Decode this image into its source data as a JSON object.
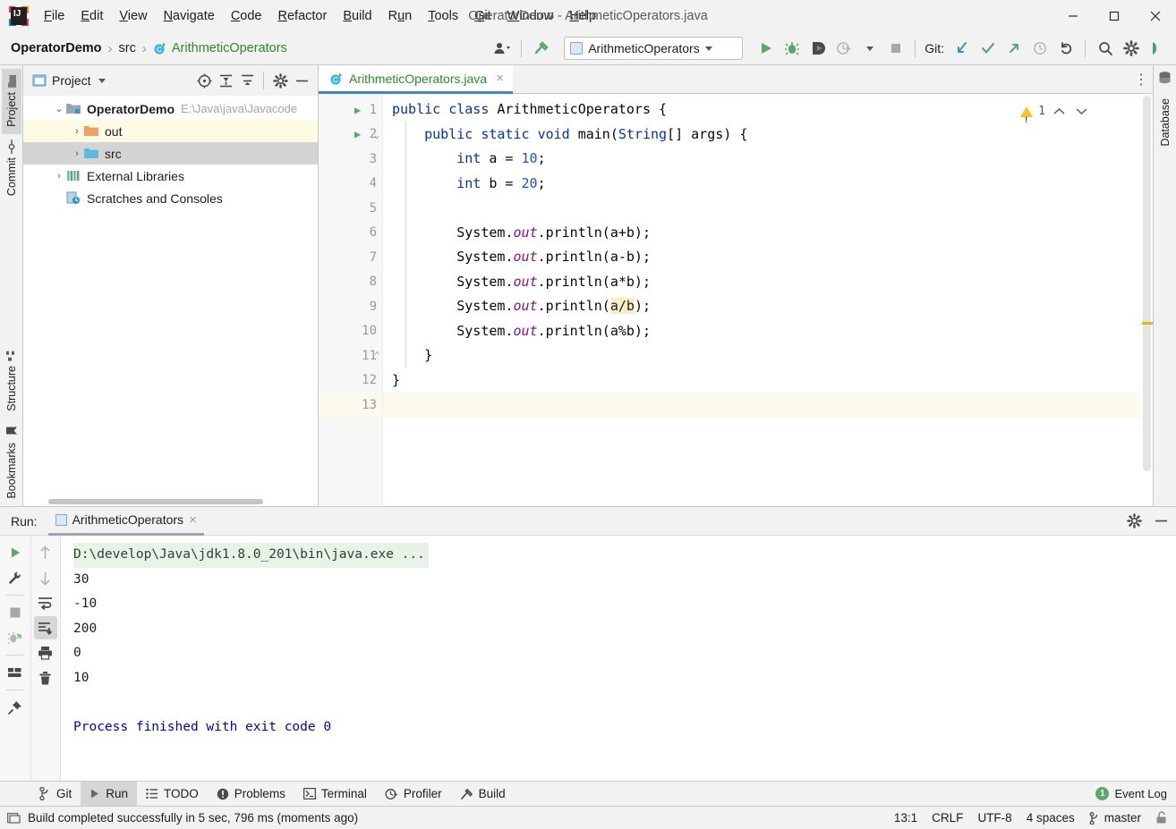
{
  "window": {
    "title": "OperatorDemo - ArithmeticOperators.java",
    "minimize": "–",
    "maximize": "□",
    "close": "✕"
  },
  "menu": [
    {
      "label": "File",
      "mnemonic": "F"
    },
    {
      "label": "Edit",
      "mnemonic": "E"
    },
    {
      "label": "View",
      "mnemonic": "V"
    },
    {
      "label": "Navigate",
      "mnemonic": "N"
    },
    {
      "label": "Code",
      "mnemonic": "C"
    },
    {
      "label": "Refactor",
      "mnemonic": "R"
    },
    {
      "label": "Build",
      "mnemonic": "B"
    },
    {
      "label": "Run",
      "mnemonic": "u"
    },
    {
      "label": "Tools",
      "mnemonic": "T"
    },
    {
      "label": "Git",
      "mnemonic": "G"
    },
    {
      "label": "Window",
      "mnemonic": "W"
    },
    {
      "label": "Help",
      "mnemonic": "H"
    }
  ],
  "navbar": {
    "breadcrumbs": [
      "OperatorDemo",
      "src",
      "ArithmeticOperators"
    ],
    "separator": "›",
    "run_config": "ArithmeticOperators",
    "git_label": "Git:"
  },
  "project": {
    "panel_title": "Project",
    "nodes": [
      {
        "label": "OperatorDemo",
        "path": "E:\\Java\\java\\Javacode",
        "arrow": "⌄",
        "bold": true
      },
      {
        "label": "out",
        "arrow": "›",
        "bold": false
      },
      {
        "label": "src",
        "arrow": "›",
        "bold": false
      },
      {
        "label": "External Libraries",
        "arrow": "›",
        "bold": false
      },
      {
        "label": "Scratches and Consoles",
        "arrow": "",
        "bold": false
      }
    ]
  },
  "left_strip": [
    "Project",
    "Commit",
    "Structure",
    "Bookmarks"
  ],
  "right_strip": [
    "Database"
  ],
  "editor": {
    "tab_name": "ArithmeticOperators.java",
    "tab_close": "×",
    "warning_count": "1",
    "chevron_up": "⌃",
    "chevron_down": "⌄",
    "line_numbers": [
      "1",
      "2",
      "3",
      "4",
      "5",
      "6",
      "7",
      "8",
      "9",
      "10",
      "11",
      "12",
      "13"
    ],
    "lines": [
      {
        "n": 1,
        "text": "public class ArithmeticOperators {"
      },
      {
        "n": 2,
        "text": "    public static void main(String[] args) {"
      },
      {
        "n": 3,
        "text": "        int a = 10;"
      },
      {
        "n": 4,
        "text": "        int b = 20;"
      },
      {
        "n": 5,
        "text": ""
      },
      {
        "n": 6,
        "text": "        System.out.println(a+b);"
      },
      {
        "n": 7,
        "text": "        System.out.println(a-b);"
      },
      {
        "n": 8,
        "text": "        System.out.println(a*b);"
      },
      {
        "n": 9,
        "text": "        System.out.println(a/b);"
      },
      {
        "n": 10,
        "text": "        System.out.println(a%b);"
      },
      {
        "n": 11,
        "text": "    }"
      },
      {
        "n": 12,
        "text": "}"
      },
      {
        "n": 13,
        "text": ""
      }
    ],
    "tokens": {
      "kw_public": "public",
      "kw_class": "class",
      "kw_static": "static",
      "kw_void": "void",
      "kw_int": "int",
      "type_String": "String",
      "name_class": "ArithmeticOperators",
      "name_main": "main",
      "name_args": "args",
      "var_a": "a",
      "var_b": "b",
      "lit_10": "10",
      "lit_20": "20",
      "sys": "System",
      "out": "out",
      "println": "println",
      "highlight": "a/b"
    }
  },
  "run": {
    "label": "Run:",
    "tab_name": "ArithmeticOperators",
    "tab_close": "×",
    "console": [
      {
        "text": "D:\\develop\\Java\\jdk1.8.0_201\\bin\\java.exe ...",
        "style": "cmd"
      },
      {
        "text": "30",
        "style": "plain"
      },
      {
        "text": "-10",
        "style": "plain"
      },
      {
        "text": "200",
        "style": "plain"
      },
      {
        "text": "0",
        "style": "plain"
      },
      {
        "text": "10",
        "style": "plain"
      },
      {
        "text": "",
        "style": "plain"
      },
      {
        "text": "Process finished with exit code 0",
        "style": "finish"
      }
    ]
  },
  "bottom_tabs": [
    {
      "label": "Git",
      "icon": "branch-icon",
      "active": false
    },
    {
      "label": "Run",
      "icon": "play-icon",
      "active": true
    },
    {
      "label": "TODO",
      "icon": "list-icon",
      "active": false
    },
    {
      "label": "Problems",
      "icon": "exclamation-icon",
      "active": false
    },
    {
      "label": "Terminal",
      "icon": "terminal-icon",
      "active": false
    },
    {
      "label": "Profiler",
      "icon": "profiler-icon",
      "active": false
    },
    {
      "label": "Build",
      "icon": "hammer-icon",
      "active": false
    }
  ],
  "event_log": {
    "label": "Event Log",
    "badge": "1"
  },
  "status": {
    "message": "Build completed successfully in 5 sec, 796 ms (moments ago)",
    "caret": "13:1",
    "line_sep": "CRLF",
    "encoding": "UTF-8",
    "indent": "4 spaces",
    "branch": "master"
  },
  "colors": {
    "accent_blue": "#4083c9",
    "green": "#59a869",
    "keyword": "#0033b3",
    "number": "#1750eb",
    "field": "#871094",
    "warning": "#f5c518",
    "console_cmd_bg": "#e6f3e6",
    "console_finish": "#0000cd"
  }
}
